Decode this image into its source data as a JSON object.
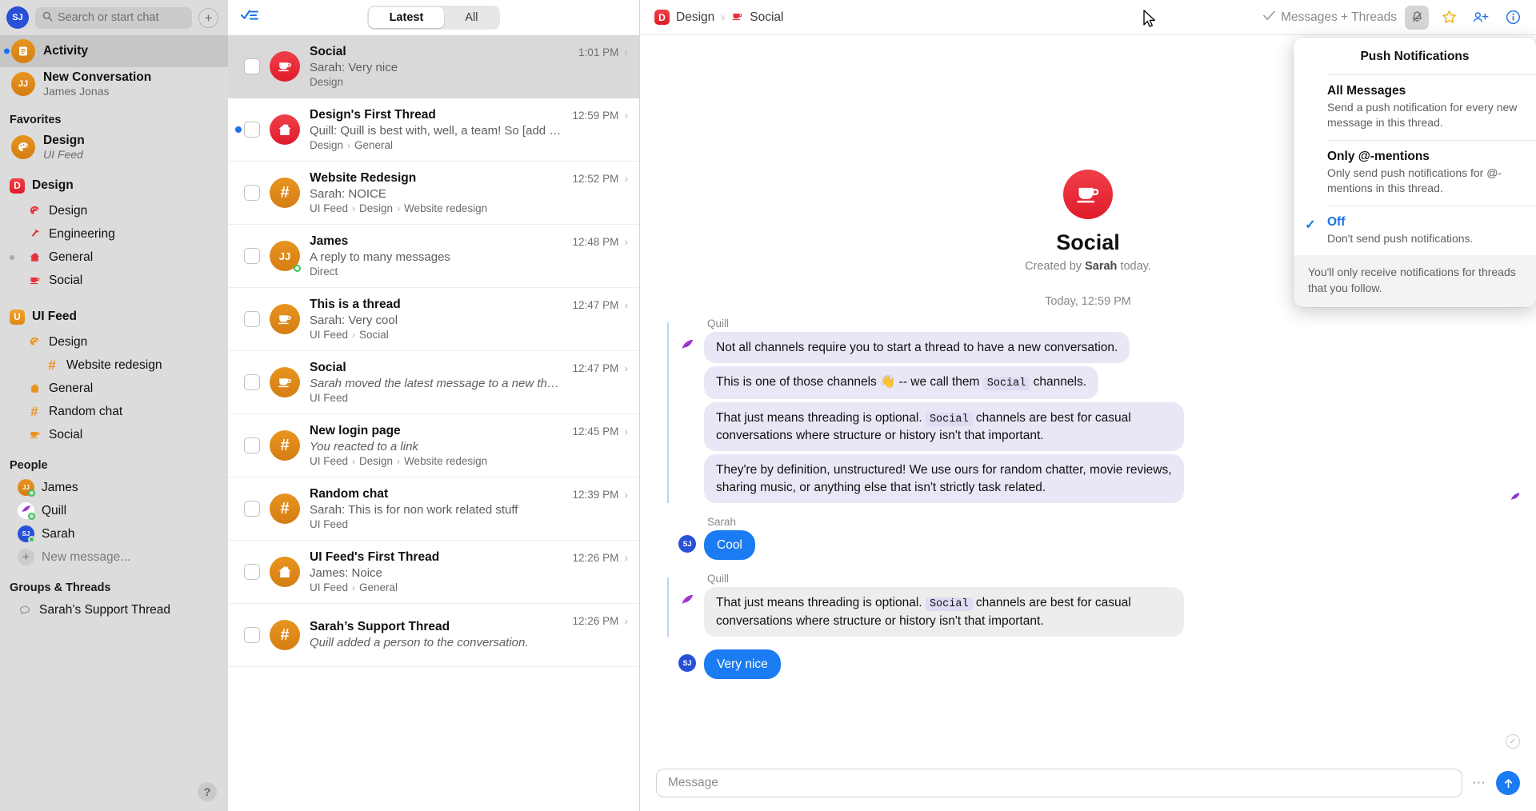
{
  "sidebar": {
    "user_avatar": "SJ",
    "search": {
      "placeholder": "Search or start chat",
      "icon": "search-icon"
    },
    "new_button": "+",
    "activity": {
      "label": "Activity",
      "icon": "activity-icon"
    },
    "new_conversation": {
      "title": "New Conversation",
      "subtitle": "James Jonas",
      "avatar": "JJ"
    },
    "favorites_header": "Favorites",
    "favorites": [
      {
        "title": "Design",
        "subtitle": "UI Feed",
        "icon": "palette-icon"
      }
    ],
    "workspaces": [
      {
        "badge": "D",
        "name": "Design",
        "badge_color": "#e01b2a",
        "channels": [
          {
            "name": "Design",
            "icon": "palette-icon",
            "unread": false
          },
          {
            "name": "Engineering",
            "icon": "hammer-icon",
            "unread": false
          },
          {
            "name": "General",
            "icon": "house-icon",
            "unread": true
          },
          {
            "name": "Social",
            "icon": "coffee-icon",
            "unread": false
          }
        ]
      },
      {
        "badge": "U",
        "name": "UI Feed",
        "badge_color": "#e8941f",
        "channels": [
          {
            "name": "Design",
            "icon": "palette-icon",
            "unread": false,
            "indent": 1
          },
          {
            "name": "Website redesign",
            "icon": "hash-icon",
            "unread": false,
            "indent": 2
          },
          {
            "name": "General",
            "icon": "house-icon",
            "unread": false,
            "indent": 1
          },
          {
            "name": "Random chat",
            "icon": "hash-icon",
            "unread": false,
            "indent": 1
          },
          {
            "name": "Social",
            "icon": "coffee-icon",
            "unread": false,
            "indent": 1
          }
        ]
      }
    ],
    "people_header": "People",
    "people": [
      {
        "name": "James",
        "avatar": "JJ",
        "color": "#d5811a",
        "status": "online-outline"
      },
      {
        "name": "Quill",
        "avatar": "Q",
        "color": "#ffffff",
        "status": "online-outline"
      },
      {
        "name": "Sarah",
        "avatar": "SJ",
        "color": "#2851d8",
        "status": "online-filled"
      }
    ],
    "new_message": "New message...",
    "groups_header": "Groups & Threads",
    "groups": [
      {
        "name": "Sarah’s Support Thread",
        "icon": "chat-bubble-icon"
      }
    ],
    "help_label": "?"
  },
  "list": {
    "compose_icon": "checklist-icon",
    "tabs": [
      {
        "label": "Latest",
        "active": true
      },
      {
        "label": "All",
        "active": false
      }
    ],
    "rows": [
      {
        "title": "Social",
        "preview": "Sarah: Very nice",
        "italic": false,
        "crumbs": [
          "Design"
        ],
        "time": "1:01 PM",
        "avatar_icon": "coffee-icon",
        "avatar_color": "red",
        "unread": false,
        "selected": true
      },
      {
        "title": "Design's First Thread",
        "preview": "Quill: Quill is best with, well, a team! So [add a me...",
        "italic": false,
        "crumbs": [
          "Design",
          "General"
        ],
        "time": "12:59 PM",
        "avatar_icon": "house-icon",
        "avatar_color": "red",
        "unread": true,
        "selected": false
      },
      {
        "title": "Website Redesign",
        "preview": "Sarah: NOICE",
        "italic": false,
        "crumbs": [
          "UI Feed",
          "Design",
          "Website redesign"
        ],
        "time": "12:52 PM",
        "avatar_icon": "hash-icon",
        "avatar_color": "orange",
        "unread": false,
        "selected": false
      },
      {
        "title": "James",
        "preview": "A reply to many messages",
        "italic": false,
        "crumbs": [
          "Direct"
        ],
        "time": "12:48 PM",
        "avatar_icon": "JJ",
        "avatar_color": "orange",
        "unread": false,
        "selected": false,
        "presence": true
      },
      {
        "title": "This is a thread",
        "preview": "Sarah: Very cool",
        "italic": false,
        "crumbs": [
          "UI Feed",
          "Social"
        ],
        "time": "12:47 PM",
        "avatar_icon": "coffee-icon",
        "avatar_color": "orange",
        "unread": false,
        "selected": false
      },
      {
        "title": "Social",
        "preview": "Sarah moved the latest message to a new thread.",
        "italic": true,
        "crumbs": [
          "UI Feed"
        ],
        "time": "12:47 PM",
        "avatar_icon": "coffee-icon",
        "avatar_color": "orange",
        "unread": false,
        "selected": false
      },
      {
        "title": "New login page",
        "preview": "You reacted to a link",
        "italic": true,
        "crumbs": [
          "UI Feed",
          "Design",
          "Website redesign"
        ],
        "time": "12:45 PM",
        "avatar_icon": "hash-icon",
        "avatar_color": "orange",
        "unread": false,
        "selected": false
      },
      {
        "title": "Random chat",
        "preview": "Sarah: This is for non work related stuff",
        "italic": false,
        "crumbs": [
          "UI Feed"
        ],
        "time": "12:39 PM",
        "avatar_icon": "hash-icon",
        "avatar_color": "orange",
        "unread": false,
        "selected": false
      },
      {
        "title": "UI Feed's First Thread",
        "preview": "James: Noice",
        "italic": false,
        "crumbs": [
          "UI Feed",
          "General"
        ],
        "time": "12:26 PM",
        "avatar_icon": "house-icon",
        "avatar_color": "orange",
        "unread": false,
        "selected": false
      },
      {
        "title": "Sarah’s Support Thread",
        "preview": "Quill added a person to the conversation.",
        "italic": true,
        "crumbs": [],
        "time": "12:26 PM",
        "avatar_icon": "hash-icon",
        "avatar_color": "orange",
        "unread": false,
        "selected": false
      }
    ]
  },
  "header": {
    "workspace_badge": "D",
    "workspace": "Design",
    "channel": "Social",
    "channel_icon": "coffee-icon",
    "filter_label": "Messages + Threads",
    "filter_icon": "check-icon",
    "icons": [
      "bell-icon",
      "star-icon",
      "add-people-icon",
      "info-icon"
    ]
  },
  "conversation": {
    "hero_icon": "coffee-icon",
    "title": "Social",
    "created_prefix": "Created by ",
    "created_by": "Sarah",
    "created_suffix": " today.",
    "daystamp": "Today, 12:59 PM",
    "groups": [
      {
        "author": "Quill",
        "avatar": "quill-icon",
        "messages": [
          {
            "segments": [
              {
                "t": "Not all channels require you to start a thread to have a new conversation."
              }
            ]
          },
          {
            "segments": [
              {
                "t": "This is one of those channels 👋 -- we call them "
              },
              {
                "code": "Social"
              },
              {
                "t": " channels."
              }
            ]
          },
          {
            "segments": [
              {
                "t": "That just means threading is optional. "
              },
              {
                "code": "Social"
              },
              {
                "t": " channels are best for casual conversations where structure or history isn't that important."
              }
            ]
          },
          {
            "segments": [
              {
                "t": "They're by definition, unstructured! We use ours for random chatter, movie reviews, sharing music, or anything else that isn't strictly task related."
              }
            ]
          }
        ]
      },
      {
        "author": "Sarah",
        "avatar": "SJ",
        "blue": true,
        "messages": [
          {
            "segments": [
              {
                "t": "Cool"
              }
            ]
          }
        ]
      },
      {
        "author": "Quill",
        "avatar": "quill-icon",
        "grey": true,
        "messages": [
          {
            "segments": [
              {
                "t": "That just means threading is optional. "
              },
              {
                "code": "Social"
              },
              {
                "t": " channels are best for casual conversations where structure or history isn't that important."
              }
            ]
          }
        ]
      },
      {
        "author": "",
        "avatar": "SJ",
        "blue": true,
        "messages": [
          {
            "segments": [
              {
                "t": "Very nice"
              }
            ]
          }
        ]
      }
    ]
  },
  "composer": {
    "placeholder": "Message",
    "more_icon": "ellipsis-icon",
    "send_icon": "send-up-icon"
  },
  "popover": {
    "title": "Push Notifications",
    "options": [
      {
        "label": "All Messages",
        "desc": "Send a push notification for every new message in this thread.",
        "selected": false
      },
      {
        "label": "Only @-mentions",
        "desc": "Only send push notifications for @-mentions in this thread.",
        "selected": false
      },
      {
        "label": "Off",
        "desc": "Don't send push notifications.",
        "selected": true
      }
    ],
    "footer": "You'll only receive notifications for threads that you follow."
  },
  "colors": {
    "accent_blue": "#1a73e8",
    "red": "#e01b2a",
    "orange": "#d5811a",
    "bubble": "#e8e7f5"
  }
}
